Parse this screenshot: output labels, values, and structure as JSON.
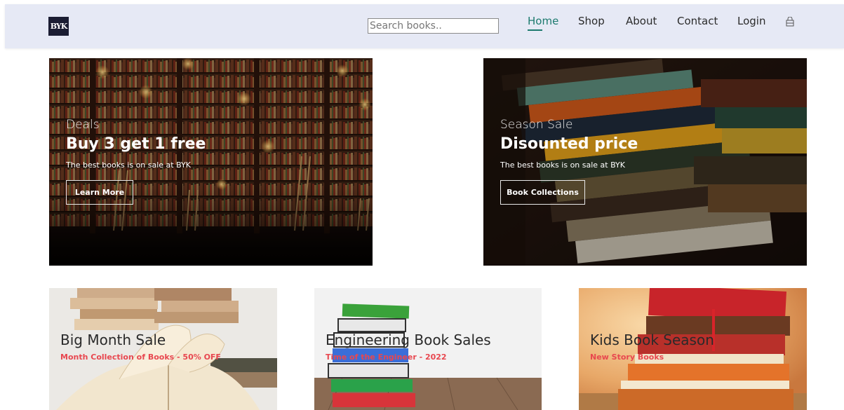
{
  "header": {
    "logo_text": "BYK",
    "search": {
      "placeholder": "Search books..",
      "value": ""
    },
    "nav": [
      {
        "label": "Home",
        "active": true
      },
      {
        "label": "Shop",
        "active": false
      },
      {
        "label": "About",
        "active": false
      },
      {
        "label": "Contact",
        "active": false
      },
      {
        "label": "Login",
        "active": false
      }
    ],
    "cart_icon": "cart-icon",
    "accent_color": "#1c7a6e",
    "background": "#e6e9f5"
  },
  "banners": [
    {
      "subtitle": "Deals",
      "title": "Buy 3 get 1 free",
      "description": "The best books is on sale at BYK",
      "button_label": "Learn More"
    },
    {
      "subtitle": "Season Sale",
      "title": "Disounted price",
      "description": "The best books is on sale at BYK",
      "button_label": "Book Collections"
    }
  ],
  "cards": [
    {
      "title": "Big Month Sale",
      "subtitle": "Month Collection of Books - 50% OFF"
    },
    {
      "title": "Engineering Book Sales",
      "subtitle": "Time of the Engineer - 2022"
    },
    {
      "title": "Kids Book Season",
      "subtitle": "New Story Books"
    }
  ],
  "colors": {
    "card_subtitle": "#e8474f",
    "logo_bg": "#1b1d33"
  }
}
